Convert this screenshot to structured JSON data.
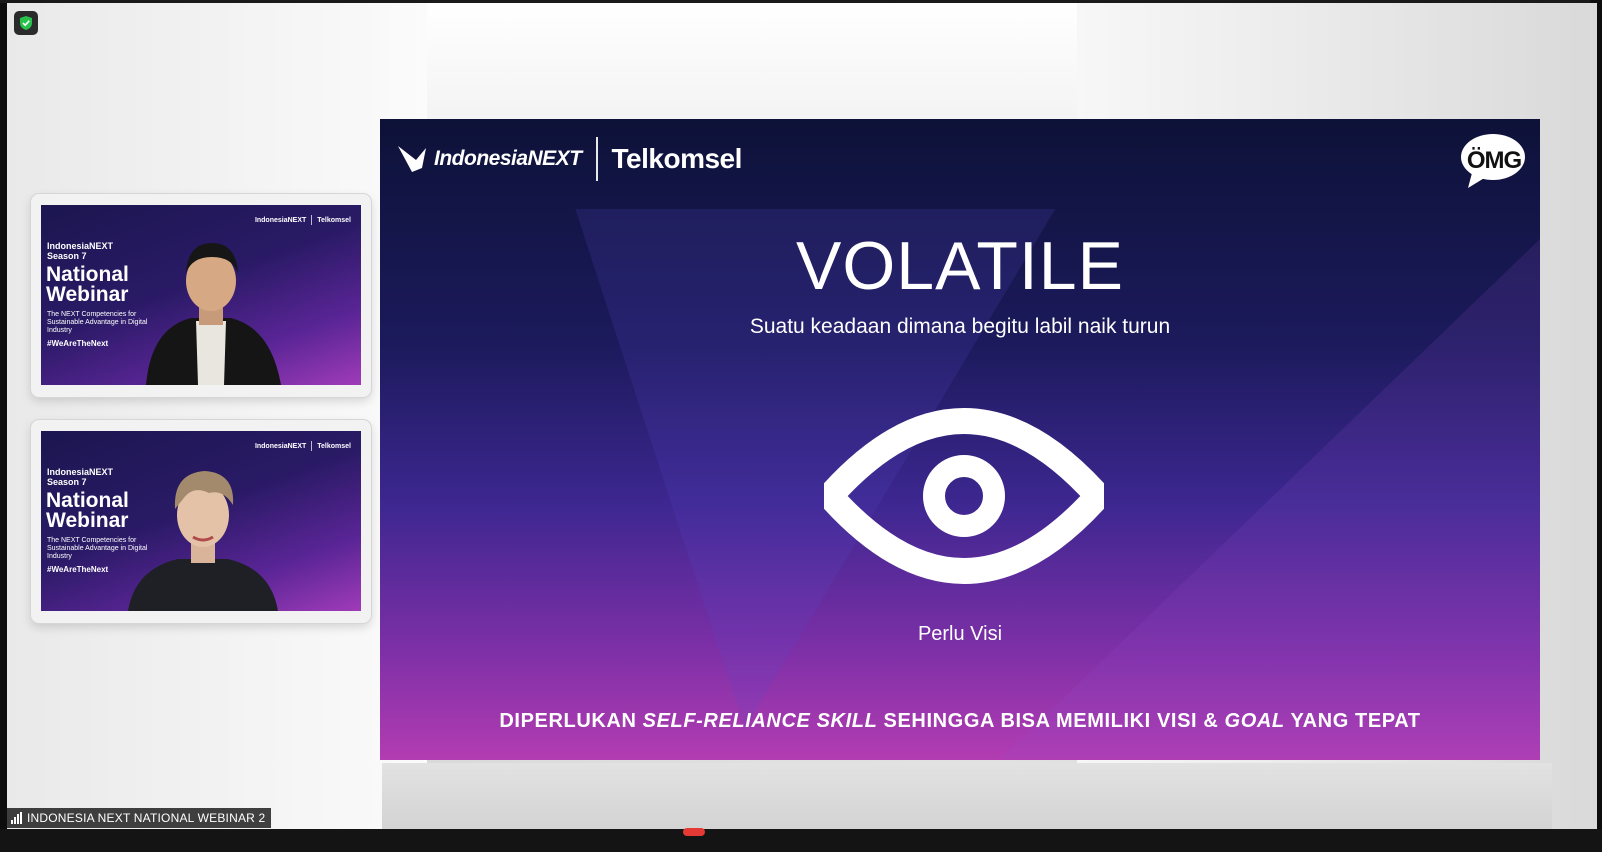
{
  "window": {
    "meeting_name": "INDONESIA NEXT NATIONAL WEBINAR 2"
  },
  "security": {
    "icon": "shield-check-icon",
    "color": "#27c24c"
  },
  "participants": [
    {
      "brand_left": "IndonesiaNEXT",
      "brand_right": "Telkomsel",
      "season_line1": "IndonesiaNEXT",
      "season_line2": "Season 7",
      "title_line1": "National",
      "title_line2": "Webinar",
      "subtitle": "The NEXT Competencies for Sustainable Advantage in Digital Industry",
      "hashtag": "#WeAreTheNext"
    },
    {
      "brand_left": "IndonesiaNEXT",
      "brand_right": "Telkomsel",
      "season_line1": "IndonesiaNEXT",
      "season_line2": "Season 7",
      "title_line1": "National",
      "title_line2": "Webinar",
      "subtitle": "The NEXT Competencies for Sustainable Advantage in Digital Industry",
      "hashtag": "#WeAreTheNext"
    }
  ],
  "slide": {
    "brand_left": "IndonesiaNEXT",
    "brand_right": "Telkomsel",
    "corner_logo": "ÖMG",
    "title": "VOLATILE",
    "subtitle": "Suatu keadaan dimana begitu labil naik turun",
    "icon": "eye-icon",
    "caption": "Perlu Visi",
    "bottom_part1": "DIPERLUKAN ",
    "bottom_italic1": "SELF-RELIANCE SKILL",
    "bottom_part2": " SEHINGGA BISA MEMILIKI VISI & ",
    "bottom_italic2": "GOAL",
    "bottom_part3": " YANG TEPAT"
  },
  "colors": {
    "slide_top": "#0d1238",
    "slide_bottom": "#b33cb2",
    "accent_red": "#e53935"
  }
}
